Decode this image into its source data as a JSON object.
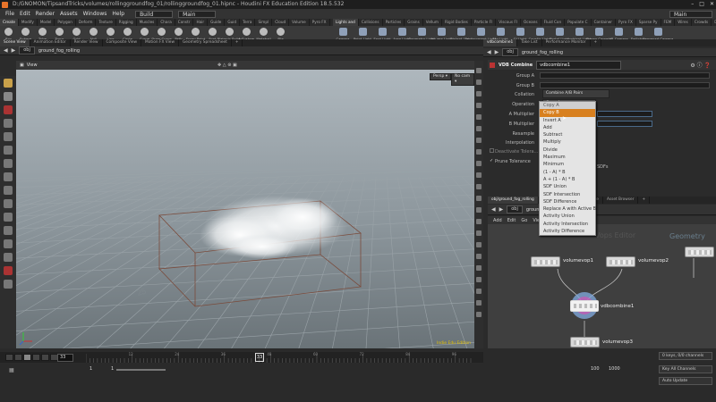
{
  "window": {
    "title": "D:/GNOMON/TipsandTricks/volumes/rollinggroundfog_01/rollinggroundfog_01.hipnc - Houdini FX Education Edition 18.5.532"
  },
  "menubar": {
    "items": [
      "File",
      "Edit",
      "Render",
      "Assets",
      "Windows",
      "Help"
    ],
    "desktop": "Build",
    "pane_tab": "Main",
    "right_tab": "Main"
  },
  "shelf": {
    "tabs": [
      "Create",
      "Modify",
      "Model",
      "Polygon",
      "Deform",
      "Texture",
      "Rigging",
      "Muscles",
      "Chara",
      "Constr",
      "Hair",
      "Guide",
      "Guid",
      "Terra",
      "Simpl",
      "Cloud",
      "Volume",
      "Pyro FX",
      "+"
    ],
    "tools": [
      "Box",
      "Sphere",
      "Tube",
      "Torus",
      "Grid",
      "Null",
      "Line",
      "Circle",
      "Curve",
      "Draw Curve",
      "Path",
      "Spray Paint",
      "Font",
      "Platonic Solids",
      "L-System",
      "Metaball",
      "File"
    ],
    "right_tabs": [
      "Lights and",
      "Collisions",
      "Particles",
      "Grains",
      "Vellum",
      "Rigid Bodies",
      "Particle Fl",
      "Viscous Fl",
      "Oceans",
      "Fluid Con",
      "Populate C",
      "Container",
      "Pyro FX",
      "Sparse Py",
      "FEM",
      "Wires",
      "Crowds",
      "Drive Sim"
    ],
    "right_tools": [
      "Camera",
      "Point Light",
      "Spot Light",
      "Area Light",
      "Geometry Light",
      "Volume Light",
      "Distant Light",
      "Environment Light",
      "Sky Light",
      "GI Light",
      "Caustic Light",
      "Portal Light",
      "Ambient Light",
      "Stereo Camera",
      "VR Camera",
      "Switcher",
      "Gamepad Camera"
    ]
  },
  "left_tabs": [
    "Scene View",
    "Animation Editor",
    "Render View",
    "Composite View",
    "Motion FX View",
    "Geometry Spreadsheet",
    "+"
  ],
  "path": {
    "obj": "obj",
    "node": "ground_fog_rolling"
  },
  "viewport": {
    "label": "View",
    "persp": "Persp ▾",
    "cam": "No cam ▾",
    "grid_label": "25",
    "overlay": "Indie Edu Edition"
  },
  "right_tabs": [
    "vdbcombine1",
    "Take List",
    "Performance Monitor",
    "+"
  ],
  "param": {
    "node_type": "VDB Combine",
    "node_name": "vdbcombine1",
    "labels": {
      "group_a": "Group A",
      "group_b": "Group B",
      "collation": "Collation",
      "operation": "Operation",
      "a_mult": "A Multiplier",
      "b_mult": "B Multiplier",
      "resample": "Resample",
      "interp": "Interpolation",
      "deactivate": "Deactivate Tolera...",
      "prune": "Prune Tolerance"
    },
    "collation_value": "Combine A/B Pairs",
    "operation_value": "Copy A",
    "flag_text": "SDFs"
  },
  "operation_menu": [
    "Copy A",
    "Copy B",
    "Invert A",
    "Add",
    "Subtract",
    "Multiply",
    "Divide",
    "Maximum",
    "Minimum",
    "(1 - A) * B",
    "A + (1 - A) * B",
    "SDF Union",
    "SDF Intersection",
    "SDF Difference",
    "Replace A with Active B",
    "Activity Union",
    "Activity Intersection",
    "Activity Difference"
  ],
  "operation_selected": "Copy B",
  "net": {
    "tabs": [
      "obj/ground_fog_rolling",
      "Tree View",
      "Material Palette",
      "Asset Browser",
      "+"
    ],
    "path": "obj",
    "path_node": "ground_fog_rolling",
    "menu": [
      "Add",
      "Edit",
      "Go",
      "View"
    ],
    "watermark1": "Vops Editor",
    "watermark2": "Geometry",
    "nodes": [
      {
        "label": "volumevop1"
      },
      {
        "label": "volumevop2"
      },
      {
        "label": "vdbcombine1"
      },
      {
        "label": "volumevop3"
      }
    ]
  },
  "timeline": {
    "frame": "33",
    "start": "1",
    "start2": "1",
    "end": "100",
    "end2": "1000",
    "ticks": [
      "12",
      "24",
      "36",
      "48",
      "60",
      "72",
      "84",
      "96"
    ]
  },
  "status": {
    "keys": "0 keys, 0/0 channels",
    "key_all": "Key All Channels",
    "auto_update": "Auto Update"
  }
}
